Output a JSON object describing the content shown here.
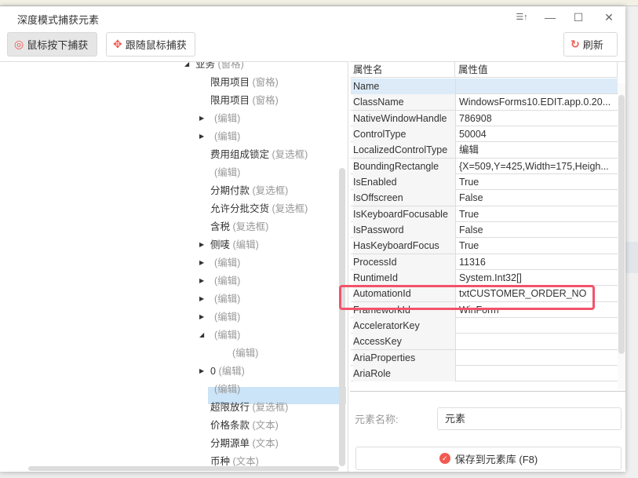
{
  "window": {
    "title": "深度模式捕获元素"
  },
  "toolbar": {
    "mouse_down_capture": "鼠标按下捕获",
    "follow_mouse_capture": "跟随鼠标捕获",
    "refresh": "刷新"
  },
  "tree": {
    "rows": [
      {
        "label": "业务",
        "type": "(窗格)",
        "level": 0,
        "arrow": "expanded"
      },
      {
        "label": "限用项目",
        "type": "(窗格)",
        "level": 1,
        "arrow": ""
      },
      {
        "label": "限用项目",
        "type": "(窗格)",
        "level": 1,
        "arrow": ""
      },
      {
        "label": "",
        "type": "(编辑)",
        "level": 1,
        "arrow": "collapsed"
      },
      {
        "label": "",
        "type": "(编辑)",
        "level": 1,
        "arrow": "collapsed"
      },
      {
        "label": "费用组成锁定",
        "type": "(复选框)",
        "level": 1,
        "arrow": ""
      },
      {
        "label": "",
        "type": "(编辑)",
        "level": 1,
        "arrow": ""
      },
      {
        "label": "分期付款",
        "type": "(复选框)",
        "level": 1,
        "arrow": ""
      },
      {
        "label": "允许分批交货",
        "type": "(复选框)",
        "level": 1,
        "arrow": ""
      },
      {
        "label": "含税",
        "type": "(复选框)",
        "level": 1,
        "arrow": ""
      },
      {
        "label": "侧唛",
        "type": "(编辑)",
        "level": 1,
        "arrow": "collapsed"
      },
      {
        "label": "",
        "type": "(编辑)",
        "level": 1,
        "arrow": "collapsed"
      },
      {
        "label": "",
        "type": "(编辑)",
        "level": 1,
        "arrow": "collapsed"
      },
      {
        "label": "",
        "type": "(编辑)",
        "level": 1,
        "arrow": "collapsed"
      },
      {
        "label": "",
        "type": "(编辑)",
        "level": 1,
        "arrow": "collapsed"
      },
      {
        "label": "",
        "type": "(编辑)",
        "level": 1,
        "arrow": "expanded"
      },
      {
        "label": "",
        "type": "(编辑)",
        "level": 2,
        "arrow": ""
      },
      {
        "label": "0",
        "type": "(编辑)",
        "level": 1,
        "arrow": "collapsed"
      },
      {
        "label": "",
        "type": "(编辑)",
        "level": 1,
        "arrow": "",
        "selected": true
      },
      {
        "label": "超限放行",
        "type": "(复选框)",
        "level": 1,
        "arrow": ""
      },
      {
        "label": "价格条款",
        "type": "(文本)",
        "level": 1,
        "arrow": ""
      },
      {
        "label": "分期源单",
        "type": "(文本)",
        "level": 1,
        "arrow": ""
      },
      {
        "label": "币种",
        "type": "(文本)",
        "level": 1,
        "arrow": ""
      }
    ]
  },
  "properties": {
    "header_name": "属性名",
    "header_value": "属性值",
    "rows": [
      {
        "name": "Name",
        "value": ""
      },
      {
        "name": "ClassName",
        "value": "WindowsForms10.EDIT.app.0.20..."
      },
      {
        "name": "NativeWindowHandle",
        "value": "786908"
      },
      {
        "name": "ControlType",
        "value": "50004"
      },
      {
        "name": "LocalizedControlType",
        "value": "编辑"
      },
      {
        "name": "BoundingRectangle",
        "value": "{X=509,Y=425,Width=175,Heigh..."
      },
      {
        "name": "IsEnabled",
        "value": "True"
      },
      {
        "name": "IsOffscreen",
        "value": "False"
      },
      {
        "name": "IsKeyboardFocusable",
        "value": "True"
      },
      {
        "name": "IsPassword",
        "value": "False"
      },
      {
        "name": "HasKeyboardFocus",
        "value": "True"
      },
      {
        "name": "ProcessId",
        "value": "11316"
      },
      {
        "name": "RuntimeId",
        "value": "System.Int32[]"
      },
      {
        "name": "AutomationId",
        "value": "txtCUSTOMER_ORDER_NO"
      },
      {
        "name": "FrameworkId",
        "value": "WinForm"
      },
      {
        "name": "AcceleratorKey",
        "value": ""
      },
      {
        "name": "AccessKey",
        "value": ""
      },
      {
        "name": "AriaProperties",
        "value": ""
      },
      {
        "name": "AriaRole",
        "value": ""
      }
    ]
  },
  "form": {
    "element_name_label": "元素名称:",
    "element_name_value": "元素",
    "save_label": "保存到元素库 (F8)"
  },
  "colors": {
    "accent": "#f05a50",
    "highlight": "#f2536a",
    "selected": "#cce4f7"
  }
}
